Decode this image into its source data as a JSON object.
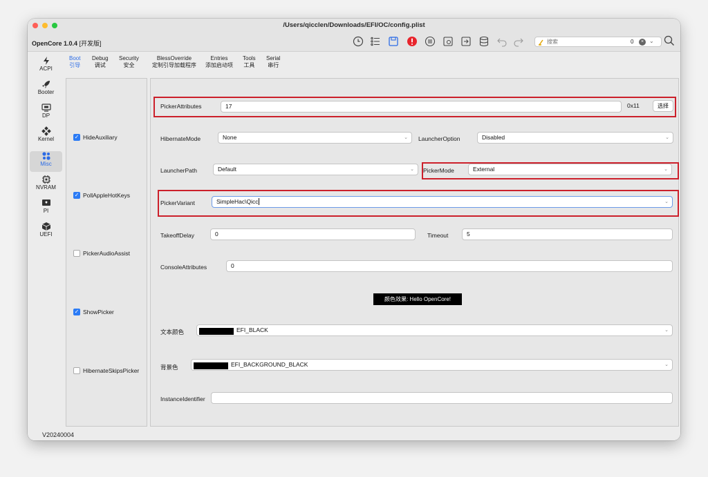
{
  "window": {
    "title": "/Users/qicclen/Downloads/EFI/OC/config.plist"
  },
  "toolbar": {
    "app_name": "OpenCore 1.0.4",
    "edition": "[开发版]",
    "icons": [
      "history-icon",
      "list-icon",
      "save-icon",
      "alert-icon",
      "compare-icon",
      "config-icon",
      "export-icon",
      "database-icon",
      "undo-icon",
      "redo-icon"
    ],
    "search_placeholder": "搜索",
    "search_count": "0"
  },
  "sidebar": {
    "items": [
      {
        "label": "ACPI",
        "icon": "lightning-icon"
      },
      {
        "label": "Booter",
        "icon": "rocket-icon"
      },
      {
        "label": "DP",
        "icon": "display-icon"
      },
      {
        "label": "Kernel",
        "icon": "kernel-icon"
      },
      {
        "label": "Misc",
        "icon": "misc-icon",
        "active": true
      },
      {
        "label": "NVRAM",
        "icon": "chip-icon"
      },
      {
        "label": "PI",
        "icon": "pi-icon"
      },
      {
        "label": "UEFI",
        "icon": "cube-icon"
      }
    ]
  },
  "tabs": [
    {
      "en": "Boot",
      "zh": "引导",
      "active": true
    },
    {
      "en": "Debug",
      "zh": "调试"
    },
    {
      "en": "Security",
      "zh": "安全"
    },
    {
      "en": "BlessOverride",
      "zh": "定制引导加载程序"
    },
    {
      "en": "Entries",
      "zh": "添加启动项"
    },
    {
      "en": "Tools",
      "zh": "工具"
    },
    {
      "en": "Serial",
      "zh": "串行"
    }
  ],
  "checkboxes": [
    {
      "label": "HideAuxiliary",
      "checked": true
    },
    {
      "label": "PollAppleHotKeys",
      "checked": true
    },
    {
      "label": "PickerAudioAssist",
      "checked": false
    },
    {
      "label": "ShowPicker",
      "checked": true
    },
    {
      "label": "HibernateSkipsPicker",
      "checked": false
    }
  ],
  "form": {
    "picker_attributes": {
      "label": "PickerAttributes",
      "value": "17",
      "hex": "0x11",
      "button": "选择"
    },
    "hibernate_mode": {
      "label": "HibernateMode",
      "value": "None"
    },
    "launcher_option": {
      "label": "LauncherOption",
      "value": "Disabled"
    },
    "launcher_path": {
      "label": "LauncherPath",
      "value": "Default"
    },
    "picker_mode": {
      "label": "PickerMode",
      "value": "External"
    },
    "picker_variant": {
      "label": "PickerVariant",
      "value": "SimpleHac\\Qicc"
    },
    "takeoff_delay": {
      "label": "TakeoffDelay",
      "value": "0"
    },
    "timeout": {
      "label": "Timeout",
      "value": "5"
    },
    "console_attributes": {
      "label": "ConsoleAttributes",
      "value": "0"
    },
    "preview_text": "颜色效果:  Hello OpenCore!",
    "text_color": {
      "label": "文本颜色",
      "value": "EFI_BLACK",
      "swatch": "#000000"
    },
    "background_color": {
      "label": "背景色",
      "value": "EFI_BACKGROUND_BLACK",
      "swatch": "#000000"
    },
    "instance_identifier": {
      "label": "InstanceIdentifier",
      "value": ""
    }
  },
  "status": {
    "version": "V20240004"
  },
  "colors": {
    "accent": "#2b6be6",
    "highlight_box": "#cc1f2a",
    "checkbox": "#2b7bf5"
  }
}
